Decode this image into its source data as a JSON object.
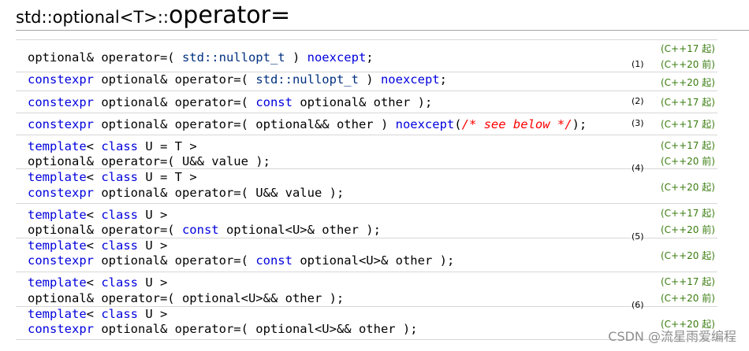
{
  "title": {
    "prefix": "std::optional<T>::",
    "name": "operator="
  },
  "overloads": [
    {
      "number": "(1)",
      "lines": [
        [
          "optional& operator=( ",
          {
            "t": "ty",
            "v": "std::nullopt_t"
          },
          " ) ",
          {
            "t": "kw",
            "v": "noexcept"
          },
          ";"
        ],
        [
          {
            "t": "kw",
            "v": "constexpr"
          },
          " optional& operator=( ",
          {
            "t": "ty",
            "v": "std::nullopt_t"
          },
          " ) ",
          {
            "t": "kw",
            "v": "noexcept"
          },
          ";"
        ]
      ],
      "versions": [
        "(C++17 起)",
        "(C++20 前)",
        "(C++20 起)"
      ]
    },
    {
      "number": "(2)",
      "lines": [
        [
          {
            "t": "kw",
            "v": "constexpr"
          },
          " optional& operator=( ",
          {
            "t": "kw",
            "v": "const"
          },
          " optional& other );"
        ]
      ],
      "versions": [
        "(C++17 起)"
      ]
    },
    {
      "number": "(3)",
      "lines": [
        [
          {
            "t": "kw",
            "v": "constexpr"
          },
          " optional& operator=( optional&& other ) ",
          {
            "t": "kw",
            "v": "noexcept"
          },
          "(",
          {
            "t": "cm",
            "v": "/* see below */"
          },
          ");"
        ]
      ],
      "versions": [
        "(C++17 起)"
      ]
    },
    {
      "number": "(4)",
      "lines": [
        [
          {
            "t": "kw",
            "v": "template"
          },
          "< ",
          {
            "t": "kw",
            "v": "class"
          },
          " U = T >"
        ],
        [
          "optional& operator=( U&& value );"
        ],
        [
          {
            "t": "kw",
            "v": "template"
          },
          "< ",
          {
            "t": "kw",
            "v": "class"
          },
          " U = T >"
        ],
        [
          {
            "t": "kw",
            "v": "constexpr"
          },
          " optional& operator=( U&& value );"
        ]
      ],
      "versions": [
        "(C++17 起)",
        "(C++20 前)",
        "(C++20 起)"
      ]
    },
    {
      "number": "(5)",
      "lines": [
        [
          {
            "t": "kw",
            "v": "template"
          },
          "< ",
          {
            "t": "kw",
            "v": "class"
          },
          " U >"
        ],
        [
          "optional& operator=( ",
          {
            "t": "kw",
            "v": "const"
          },
          " optional<U>& other );"
        ],
        [
          {
            "t": "kw",
            "v": "template"
          },
          "< ",
          {
            "t": "kw",
            "v": "class"
          },
          " U >"
        ],
        [
          {
            "t": "kw",
            "v": "constexpr"
          },
          " optional& operator=( ",
          {
            "t": "kw",
            "v": "const"
          },
          " optional<U>& other );"
        ]
      ],
      "versions": [
        "(C++17 起)",
        "(C++20 前)",
        "(C++20 起)"
      ]
    },
    {
      "number": "(6)",
      "lines": [
        [
          {
            "t": "kw",
            "v": "template"
          },
          "< ",
          {
            "t": "kw",
            "v": "class"
          },
          " U >"
        ],
        [
          "optional& operator=( optional<U>&& other );"
        ],
        [
          {
            "t": "kw",
            "v": "template"
          },
          "< ",
          {
            "t": "kw",
            "v": "class"
          },
          " U >"
        ],
        [
          {
            "t": "kw",
            "v": "constexpr"
          },
          " optional& operator=( optional<U>&& other );"
        ]
      ],
      "versions": [
        "(C++17 起)",
        "(C++20 前)",
        "(C++20 起)"
      ]
    }
  ],
  "watermark": "CSDN @流星雨爱编程",
  "colors": {
    "keyword": "#0000dd",
    "type": "#003080",
    "comment": "#ff0000",
    "version": "#3a7d10"
  }
}
